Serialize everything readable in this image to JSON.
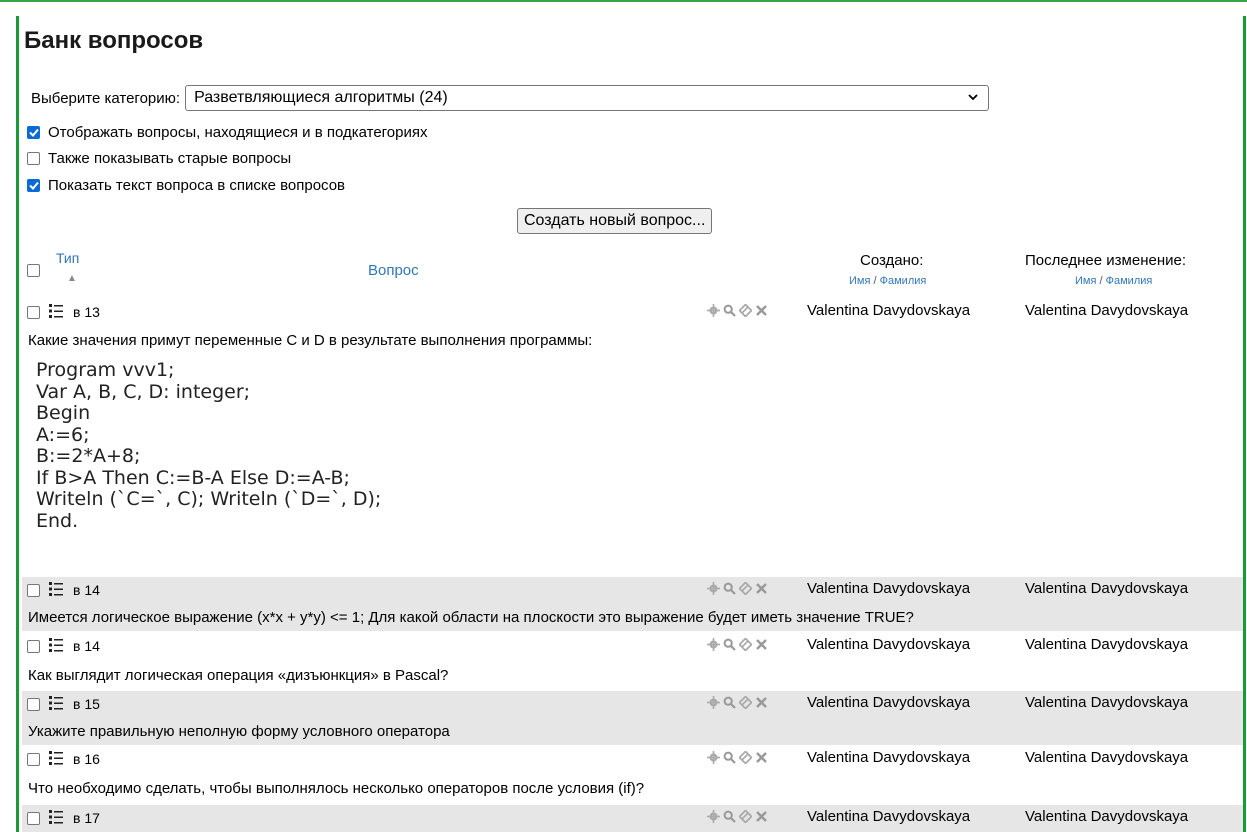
{
  "page": {
    "title": "Банк вопросов"
  },
  "category": {
    "label": "Выберите категорию:",
    "selected": "Разветвляющиеся алгоритмы (24)"
  },
  "options": [
    {
      "label": "Отображать вопросы, находящиеся и в подкатегориях",
      "checked": true
    },
    {
      "label": "Также показывать старые вопросы",
      "checked": false
    },
    {
      "label": "Показать текст вопроса в списке вопросов",
      "checked": true
    }
  ],
  "create_button": "Создать новый вопрос...",
  "table_header": {
    "type": "Тип",
    "question": "Вопрос",
    "created": "Создано:",
    "modified": "Последнее изменение:",
    "first_name": "Имя",
    "slash": "/",
    "last_name": "Фамилия"
  },
  "questions": [
    {
      "name": "в 13",
      "created_by": "Valentina Davydovskaya",
      "modified_by": "Valentina Davydovskaya",
      "text": "Какие значения примут переменные C и D в результате выполнения программы:",
      "code": "Program vvv1;\nVar A, B, C, D: integer;\nBegin\nA:=6;\nB:=2*A+8;\nIf B>A Then C:=B-A Else D:=A-B;\nWriteln (`C=`, C); Writeln (`D=`, D);\nEnd."
    },
    {
      "name": "в 14",
      "created_by": "Valentina Davydovskaya",
      "modified_by": "Valentina Davydovskaya",
      "text": "Имеется логическое выражение (x*x + y*y) <= 1; Для какой области на плоскости это выражение будет иметь значение TRUE?"
    },
    {
      "name": "в 14",
      "created_by": "Valentina Davydovskaya",
      "modified_by": "Valentina Davydovskaya",
      "text": "Как выглядит логическая операция «дизъюнкция» в Pascal?"
    },
    {
      "name": "в 15",
      "created_by": "Valentina Davydovskaya",
      "modified_by": "Valentina Davydovskaya",
      "text": "Укажите правильную неполную форму условного оператора"
    },
    {
      "name": "в 16",
      "created_by": "Valentina Davydovskaya",
      "modified_by": "Valentina Davydovskaya",
      "text": "Что необходимо сделать, чтобы выполнялось несколько операторов  после условия (if)?"
    },
    {
      "name": "в 17",
      "created_by": "Valentina Davydovskaya",
      "modified_by": "Valentina Davydovskaya"
    }
  ],
  "icons": {
    "question_type": "multichoice-list-icon",
    "actions": [
      "gear-icon",
      "search-icon",
      "move-icon",
      "delete-icon"
    ],
    "accent": "#1a9a34",
    "link": "#3377b8"
  }
}
